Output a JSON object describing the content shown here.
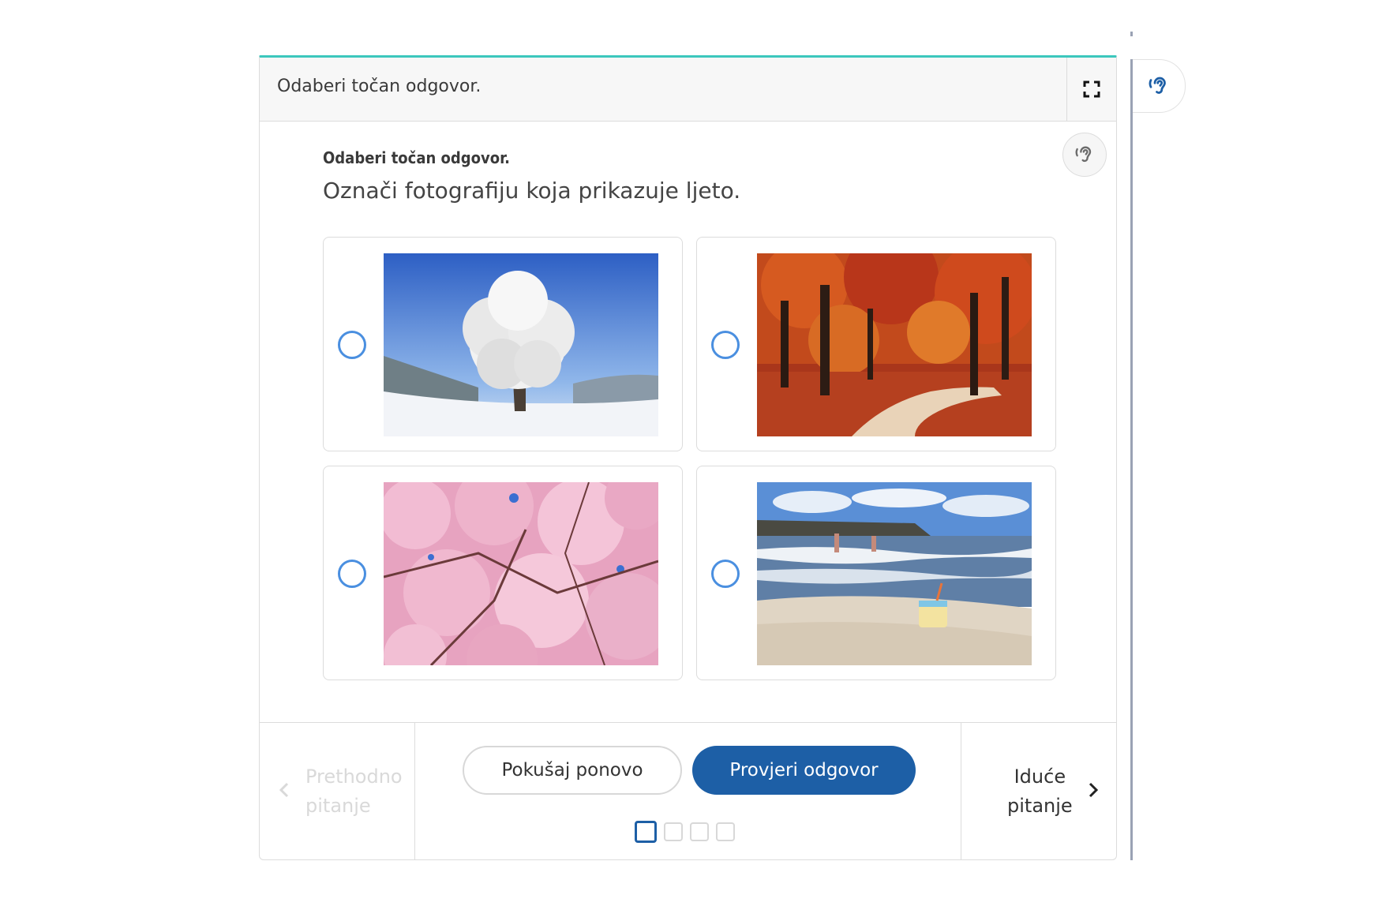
{
  "header": {
    "title": "Odaberi točan odgovor."
  },
  "question": {
    "label": "Odaberi točan odgovor.",
    "text": "Označi fotografiju koja prikazuje ljeto."
  },
  "options": [
    {
      "image": "winter-frosted-tree-photo",
      "selected": false
    },
    {
      "image": "autumn-forest-path-photo",
      "selected": false
    },
    {
      "image": "spring-cherry-blossom-photo",
      "selected": false
    },
    {
      "image": "summer-beach-photo",
      "selected": false
    }
  ],
  "footer": {
    "prev_line1": "Prethodno",
    "prev_line2": "pitanje",
    "retry_label": "Pokušaj ponovo",
    "check_label": "Provjeri odgovor",
    "next_line1": "Iduće",
    "next_line2": "pitanje"
  },
  "pagination": {
    "total": 4,
    "current": 1
  },
  "colors": {
    "accent_top": "#3cc7bd",
    "primary_button": "#1d5fa6",
    "radio": "#4a8fe0",
    "disabled_text": "#d9d9d9"
  },
  "icons": [
    "fullscreen-icon",
    "ear-listen-icon",
    "chevron-left-icon",
    "chevron-right-icon"
  ]
}
